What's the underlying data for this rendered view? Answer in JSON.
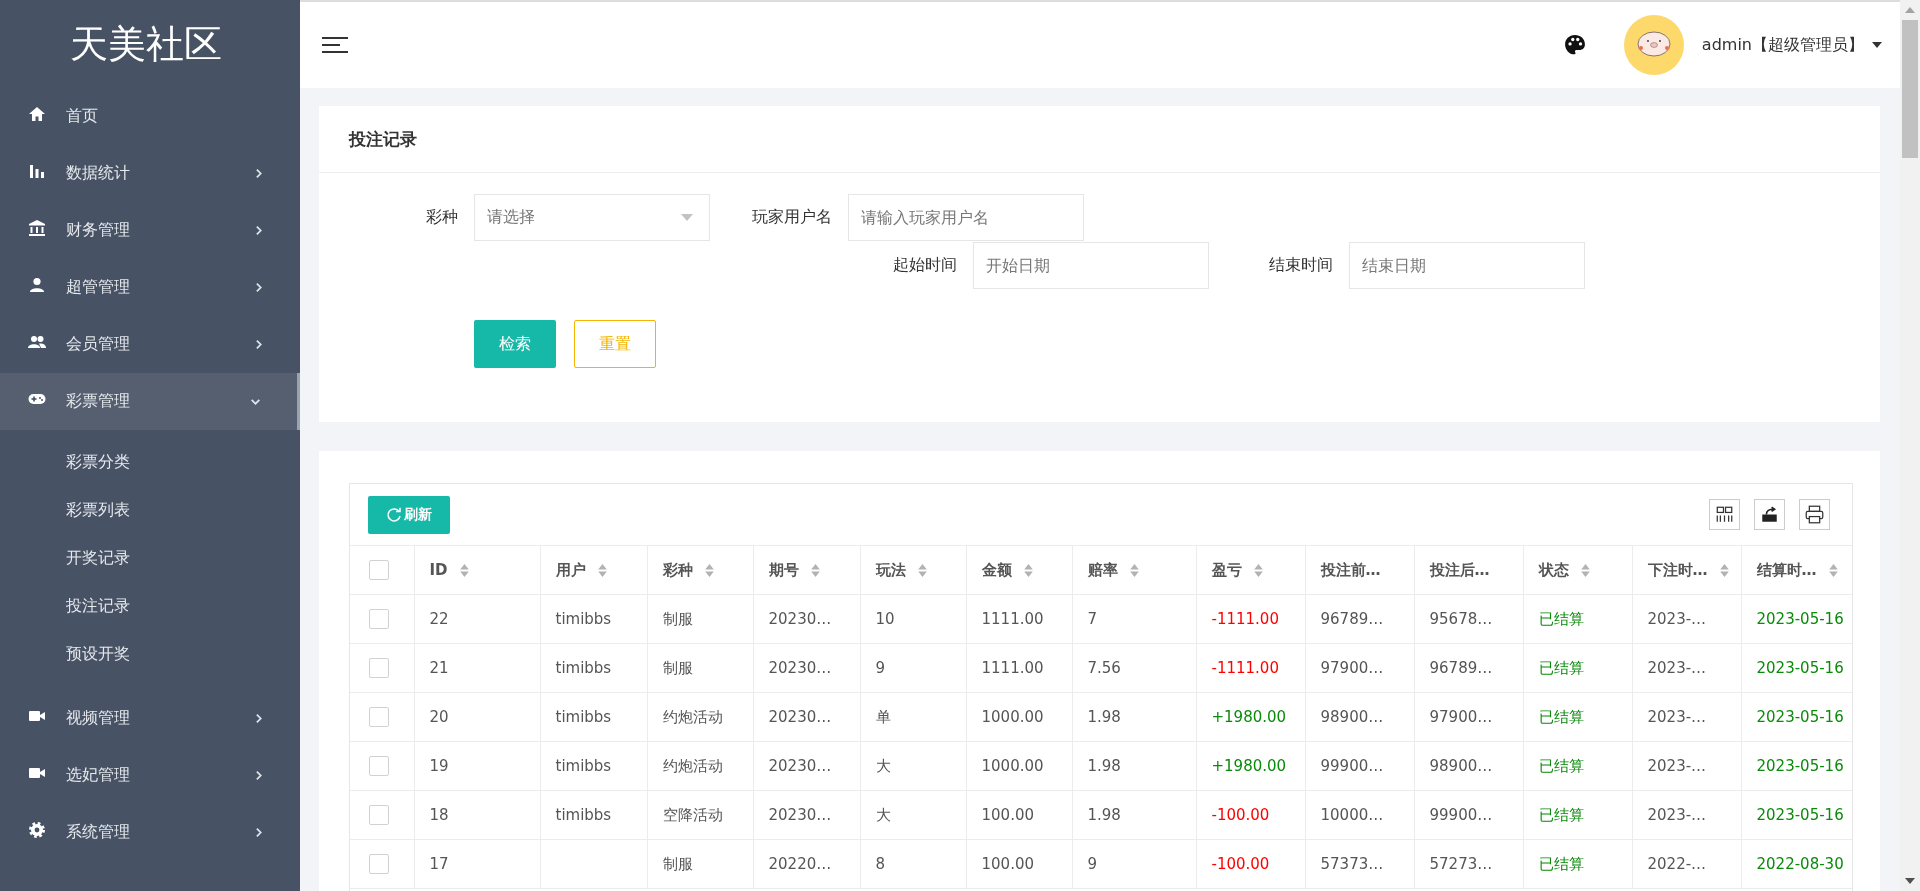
{
  "sidebar": {
    "logo": "天美社区",
    "items": [
      {
        "label": "首页",
        "kind": "home",
        "selected": false
      },
      {
        "label": "数据统计",
        "kind": "chart",
        "expanded": false,
        "selected": false
      },
      {
        "label": "财务管理",
        "kind": "bank",
        "expanded": false,
        "selected": false
      },
      {
        "label": "超管管理",
        "kind": "person",
        "expanded": false,
        "selected": false
      },
      {
        "label": "会员管理",
        "kind": "people",
        "expanded": false,
        "selected": false
      },
      {
        "label": "彩票管理",
        "kind": "gamepad",
        "expanded": true,
        "selected": true,
        "children": [
          {
            "label": "彩票分类",
            "selected": false
          },
          {
            "label": "彩票列表",
            "selected": false
          },
          {
            "label": "开奖记录",
            "selected": false
          },
          {
            "label": "投注记录",
            "selected": false
          },
          {
            "label": "预设开奖",
            "selected": false
          }
        ]
      },
      {
        "label": "视频管理",
        "kind": "video",
        "expanded": false,
        "selected": false
      },
      {
        "label": "选妃管理",
        "kind": "video",
        "expanded": false,
        "selected": false
      },
      {
        "label": "系统管理",
        "kind": "gear",
        "expanded": false,
        "selected": false
      }
    ]
  },
  "header": {
    "user": "admin【超级管理员】"
  },
  "search_form": {
    "title": "投注记录",
    "lottery": {
      "label": "彩种",
      "placeholder": "请选择"
    },
    "player": {
      "label": "玩家用户名",
      "placeholder": "请输入玩家用户名"
    },
    "start": {
      "label": "起始时间",
      "placeholder": "开始日期"
    },
    "end": {
      "label": "结束时间",
      "placeholder": "结束日期"
    },
    "buttons": [
      "检索",
      "重置"
    ]
  },
  "table": {
    "refresh_button": "刷新",
    "all_checked": false,
    "columns": [
      {
        "label": "ID",
        "sortable": true
      },
      {
        "label": "用户",
        "sortable": true
      },
      {
        "label": "彩种",
        "sortable": true
      },
      {
        "label": "期号",
        "sortable": true
      },
      {
        "label": "玩法",
        "sortable": true
      },
      {
        "label": "金额",
        "sortable": true
      },
      {
        "label": "赔率",
        "sortable": true
      },
      {
        "label": "盈亏",
        "sortable": true
      },
      {
        "label": "投注前…",
        "sortable": false
      },
      {
        "label": "投注后…",
        "sortable": false
      },
      {
        "label": "状态",
        "sortable": true
      },
      {
        "label": "下注时…",
        "sortable": true
      },
      {
        "label": "结算时…",
        "sortable": true
      }
    ],
    "rows": [
      {
        "checked": false,
        "profit_positive": false,
        "settled": true,
        "cells": [
          "22",
          "timibbs",
          "制服",
          "20230…",
          "10",
          "1111.00",
          "7",
          "-1111.00",
          "96789…",
          "95678…",
          "已结算",
          "2023-…",
          "2023-05-16"
        ]
      },
      {
        "checked": false,
        "profit_positive": false,
        "settled": true,
        "cells": [
          "21",
          "timibbs",
          "制服",
          "20230…",
          "9",
          "1111.00",
          "7.56",
          "-1111.00",
          "97900…",
          "96789…",
          "已结算",
          "2023-…",
          "2023-05-16"
        ]
      },
      {
        "checked": false,
        "profit_positive": true,
        "settled": true,
        "cells": [
          "20",
          "timibbs",
          "约炮活动",
          "20230…",
          "单",
          "1000.00",
          "1.98",
          "+1980.00",
          "98900…",
          "97900…",
          "已结算",
          "2023-…",
          "2023-05-16"
        ]
      },
      {
        "checked": false,
        "profit_positive": true,
        "settled": true,
        "cells": [
          "19",
          "timibbs",
          "约炮活动",
          "20230…",
          "大",
          "1000.00",
          "1.98",
          "+1980.00",
          "99900…",
          "98900…",
          "已结算",
          "2023-…",
          "2023-05-16"
        ]
      },
      {
        "checked": false,
        "profit_positive": false,
        "settled": true,
        "cells": [
          "18",
          "timibbs",
          "空降活动",
          "20230…",
          "大",
          "100.00",
          "1.98",
          "-100.00",
          "10000…",
          "99900…",
          "已结算",
          "2023-…",
          "2023-05-16"
        ]
      },
      {
        "checked": false,
        "profit_positive": false,
        "settled": true,
        "cells": [
          "17",
          "",
          "制服",
          "20220…",
          "8",
          "100.00",
          "9",
          "-100.00",
          "57373…",
          "57273…",
          "已结算",
          "2022-…",
          "2022-08-30"
        ]
      }
    ]
  }
}
